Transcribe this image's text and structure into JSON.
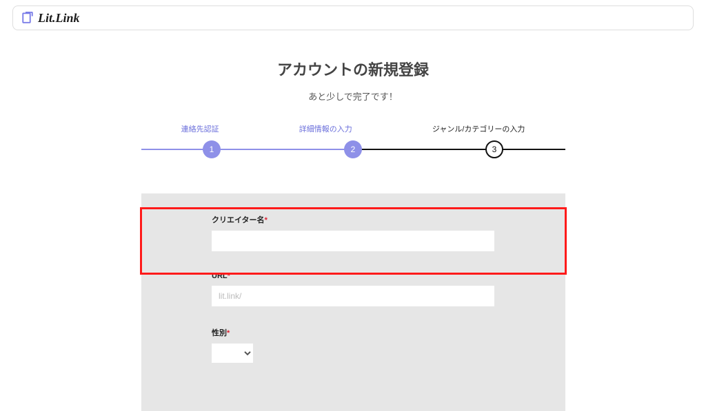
{
  "brand": {
    "name": "Lit.Link"
  },
  "page": {
    "title": "アカウントの新規登録",
    "subtitle": "あと少しで完了です！"
  },
  "stepper": {
    "steps": [
      {
        "num": "1",
        "label": "連絡先認証"
      },
      {
        "num": "2",
        "label": "詳細情報の入力"
      },
      {
        "num": "3",
        "label": "ジャンル/カテゴリーの入力"
      }
    ]
  },
  "form": {
    "creator": {
      "label": "クリエイター名",
      "required": "*",
      "value": ""
    },
    "url": {
      "label": "URL",
      "required": "*",
      "prefix": "lit.link/",
      "value": ""
    },
    "gender": {
      "label": "性別",
      "required": "*",
      "value": ""
    }
  }
}
